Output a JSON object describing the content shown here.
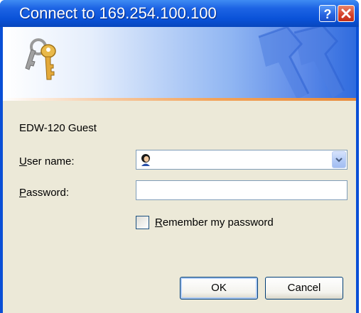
{
  "window": {
    "title": "Connect to 169.254.100.100"
  },
  "icons": {
    "banner": "keys-icon",
    "banner_background": "large-keys-watermark",
    "help": "help-icon",
    "close": "close-icon",
    "user": "user-avatar-icon",
    "dropdown": "chevron-down-icon"
  },
  "dialog": {
    "realm": "EDW-120 Guest",
    "user_label_accel": "U",
    "user_label_rest": "ser name:",
    "password_label_accel": "P",
    "password_label_rest": "assword:",
    "user_name_value": "",
    "password_value": "",
    "remember_accel": "R",
    "remember_rest": "emember my password",
    "remember_checked": false
  },
  "buttons": {
    "ok": "OK",
    "cancel": "Cancel"
  },
  "colors": {
    "titlebar": "#0a52d8",
    "client": "#ece9d8",
    "close_button": "#d4402a"
  }
}
